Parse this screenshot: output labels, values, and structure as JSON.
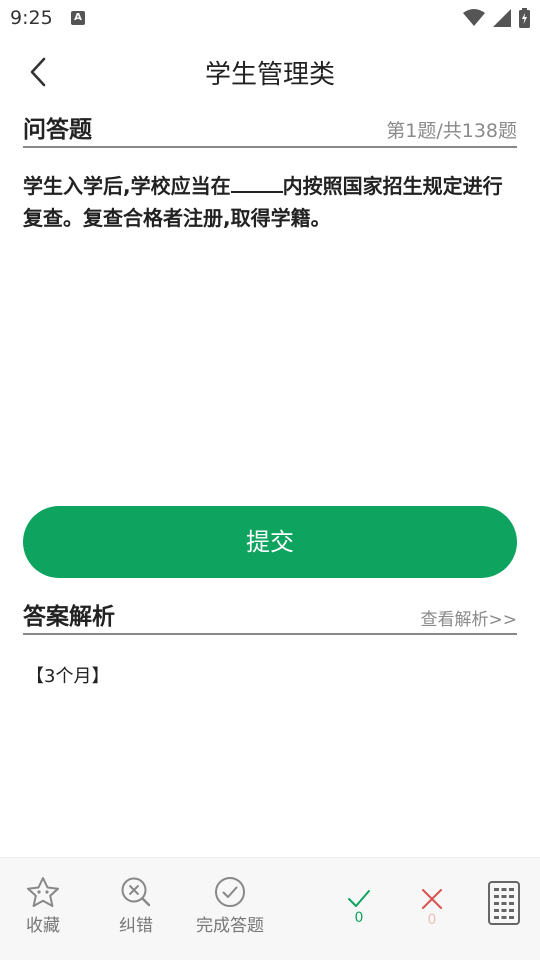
{
  "status_bar": {
    "time": "9:25",
    "notification_letter": "A"
  },
  "header": {
    "title": "学生管理类"
  },
  "question": {
    "type_label": "问答题",
    "progress": "第1题/共138题",
    "text_before": "学生入学后,学校应当在",
    "text_after": "内按照国家招生规定进行复查。复查合格者注册,取得学籍。"
  },
  "submit": {
    "label": "提交"
  },
  "analysis": {
    "title": "答案解析",
    "view_link": "查看解析>>",
    "answer": "【3个月】"
  },
  "bottom_bar": {
    "favorite_label": "收藏",
    "correct_error_label": "纠错",
    "finish_label": "完成答题",
    "correct_count": "0",
    "wrong_count": "0"
  },
  "colors": {
    "accent": "#0ea35f",
    "wrong": "#d9534f"
  }
}
